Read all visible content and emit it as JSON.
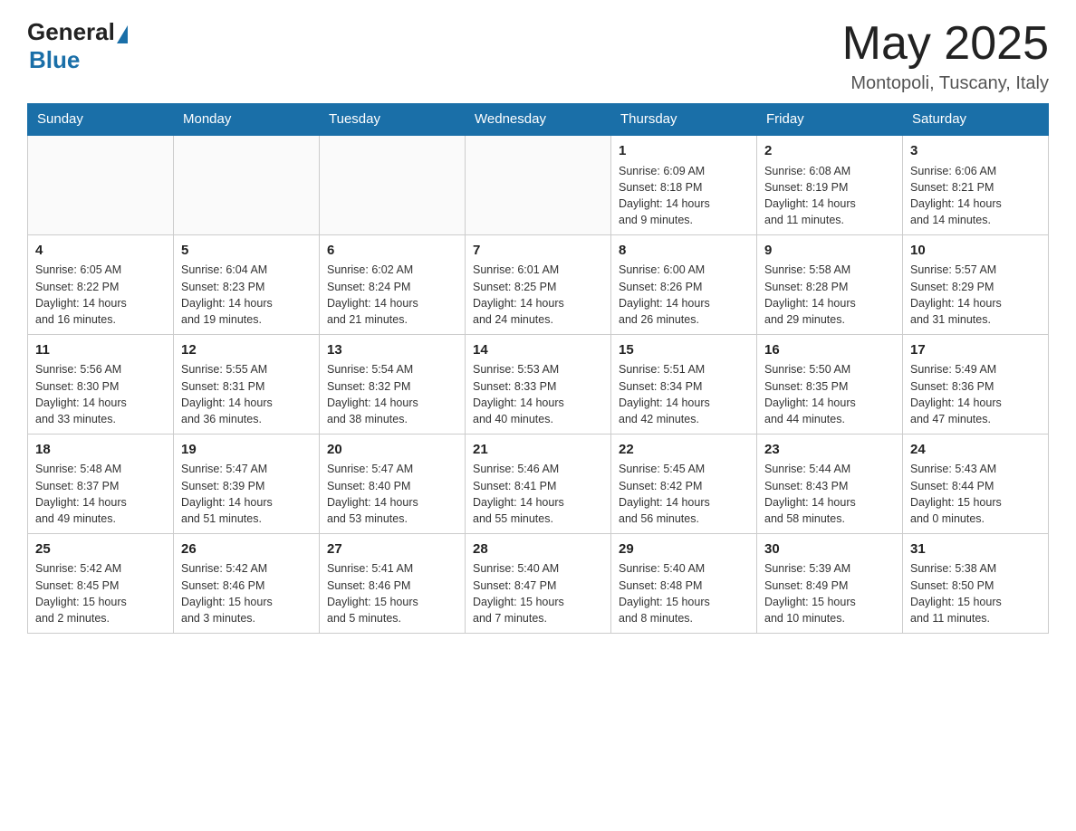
{
  "header": {
    "logo_general": "General",
    "logo_blue": "Blue",
    "month_title": "May 2025",
    "location": "Montopoli, Tuscany, Italy"
  },
  "weekdays": [
    "Sunday",
    "Monday",
    "Tuesday",
    "Wednesday",
    "Thursday",
    "Friday",
    "Saturday"
  ],
  "weeks": [
    [
      {
        "day": "",
        "info": ""
      },
      {
        "day": "",
        "info": ""
      },
      {
        "day": "",
        "info": ""
      },
      {
        "day": "",
        "info": ""
      },
      {
        "day": "1",
        "info": "Sunrise: 6:09 AM\nSunset: 8:18 PM\nDaylight: 14 hours\nand 9 minutes."
      },
      {
        "day": "2",
        "info": "Sunrise: 6:08 AM\nSunset: 8:19 PM\nDaylight: 14 hours\nand 11 minutes."
      },
      {
        "day": "3",
        "info": "Sunrise: 6:06 AM\nSunset: 8:21 PM\nDaylight: 14 hours\nand 14 minutes."
      }
    ],
    [
      {
        "day": "4",
        "info": "Sunrise: 6:05 AM\nSunset: 8:22 PM\nDaylight: 14 hours\nand 16 minutes."
      },
      {
        "day": "5",
        "info": "Sunrise: 6:04 AM\nSunset: 8:23 PM\nDaylight: 14 hours\nand 19 minutes."
      },
      {
        "day": "6",
        "info": "Sunrise: 6:02 AM\nSunset: 8:24 PM\nDaylight: 14 hours\nand 21 minutes."
      },
      {
        "day": "7",
        "info": "Sunrise: 6:01 AM\nSunset: 8:25 PM\nDaylight: 14 hours\nand 24 minutes."
      },
      {
        "day": "8",
        "info": "Sunrise: 6:00 AM\nSunset: 8:26 PM\nDaylight: 14 hours\nand 26 minutes."
      },
      {
        "day": "9",
        "info": "Sunrise: 5:58 AM\nSunset: 8:28 PM\nDaylight: 14 hours\nand 29 minutes."
      },
      {
        "day": "10",
        "info": "Sunrise: 5:57 AM\nSunset: 8:29 PM\nDaylight: 14 hours\nand 31 minutes."
      }
    ],
    [
      {
        "day": "11",
        "info": "Sunrise: 5:56 AM\nSunset: 8:30 PM\nDaylight: 14 hours\nand 33 minutes."
      },
      {
        "day": "12",
        "info": "Sunrise: 5:55 AM\nSunset: 8:31 PM\nDaylight: 14 hours\nand 36 minutes."
      },
      {
        "day": "13",
        "info": "Sunrise: 5:54 AM\nSunset: 8:32 PM\nDaylight: 14 hours\nand 38 minutes."
      },
      {
        "day": "14",
        "info": "Sunrise: 5:53 AM\nSunset: 8:33 PM\nDaylight: 14 hours\nand 40 minutes."
      },
      {
        "day": "15",
        "info": "Sunrise: 5:51 AM\nSunset: 8:34 PM\nDaylight: 14 hours\nand 42 minutes."
      },
      {
        "day": "16",
        "info": "Sunrise: 5:50 AM\nSunset: 8:35 PM\nDaylight: 14 hours\nand 44 minutes."
      },
      {
        "day": "17",
        "info": "Sunrise: 5:49 AM\nSunset: 8:36 PM\nDaylight: 14 hours\nand 47 minutes."
      }
    ],
    [
      {
        "day": "18",
        "info": "Sunrise: 5:48 AM\nSunset: 8:37 PM\nDaylight: 14 hours\nand 49 minutes."
      },
      {
        "day": "19",
        "info": "Sunrise: 5:47 AM\nSunset: 8:39 PM\nDaylight: 14 hours\nand 51 minutes."
      },
      {
        "day": "20",
        "info": "Sunrise: 5:47 AM\nSunset: 8:40 PM\nDaylight: 14 hours\nand 53 minutes."
      },
      {
        "day": "21",
        "info": "Sunrise: 5:46 AM\nSunset: 8:41 PM\nDaylight: 14 hours\nand 55 minutes."
      },
      {
        "day": "22",
        "info": "Sunrise: 5:45 AM\nSunset: 8:42 PM\nDaylight: 14 hours\nand 56 minutes."
      },
      {
        "day": "23",
        "info": "Sunrise: 5:44 AM\nSunset: 8:43 PM\nDaylight: 14 hours\nand 58 minutes."
      },
      {
        "day": "24",
        "info": "Sunrise: 5:43 AM\nSunset: 8:44 PM\nDaylight: 15 hours\nand 0 minutes."
      }
    ],
    [
      {
        "day": "25",
        "info": "Sunrise: 5:42 AM\nSunset: 8:45 PM\nDaylight: 15 hours\nand 2 minutes."
      },
      {
        "day": "26",
        "info": "Sunrise: 5:42 AM\nSunset: 8:46 PM\nDaylight: 15 hours\nand 3 minutes."
      },
      {
        "day": "27",
        "info": "Sunrise: 5:41 AM\nSunset: 8:46 PM\nDaylight: 15 hours\nand 5 minutes."
      },
      {
        "day": "28",
        "info": "Sunrise: 5:40 AM\nSunset: 8:47 PM\nDaylight: 15 hours\nand 7 minutes."
      },
      {
        "day": "29",
        "info": "Sunrise: 5:40 AM\nSunset: 8:48 PM\nDaylight: 15 hours\nand 8 minutes."
      },
      {
        "day": "30",
        "info": "Sunrise: 5:39 AM\nSunset: 8:49 PM\nDaylight: 15 hours\nand 10 minutes."
      },
      {
        "day": "31",
        "info": "Sunrise: 5:38 AM\nSunset: 8:50 PM\nDaylight: 15 hours\nand 11 minutes."
      }
    ]
  ]
}
